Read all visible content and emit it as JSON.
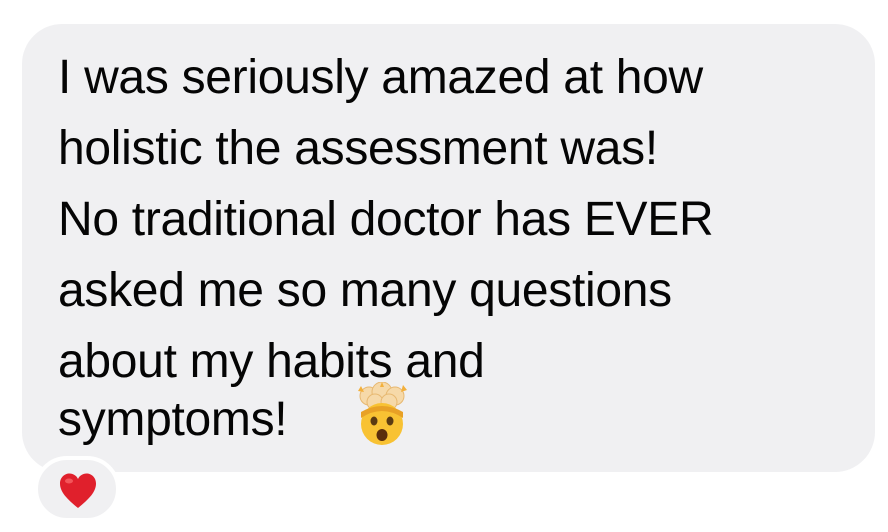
{
  "message": {
    "lines": [
      "I was seriously amazed at how",
      "holistic the assessment was!",
      "No traditional doctor has EVER",
      "asked me so many questions",
      "about my habits and",
      "symptoms!"
    ],
    "emoji": "mind-blown-emoji-icon"
  },
  "reaction": {
    "icon": "heart-icon",
    "color": "#e0202c"
  },
  "colors": {
    "bubble": "#f0f0f2",
    "text": "#050505"
  }
}
